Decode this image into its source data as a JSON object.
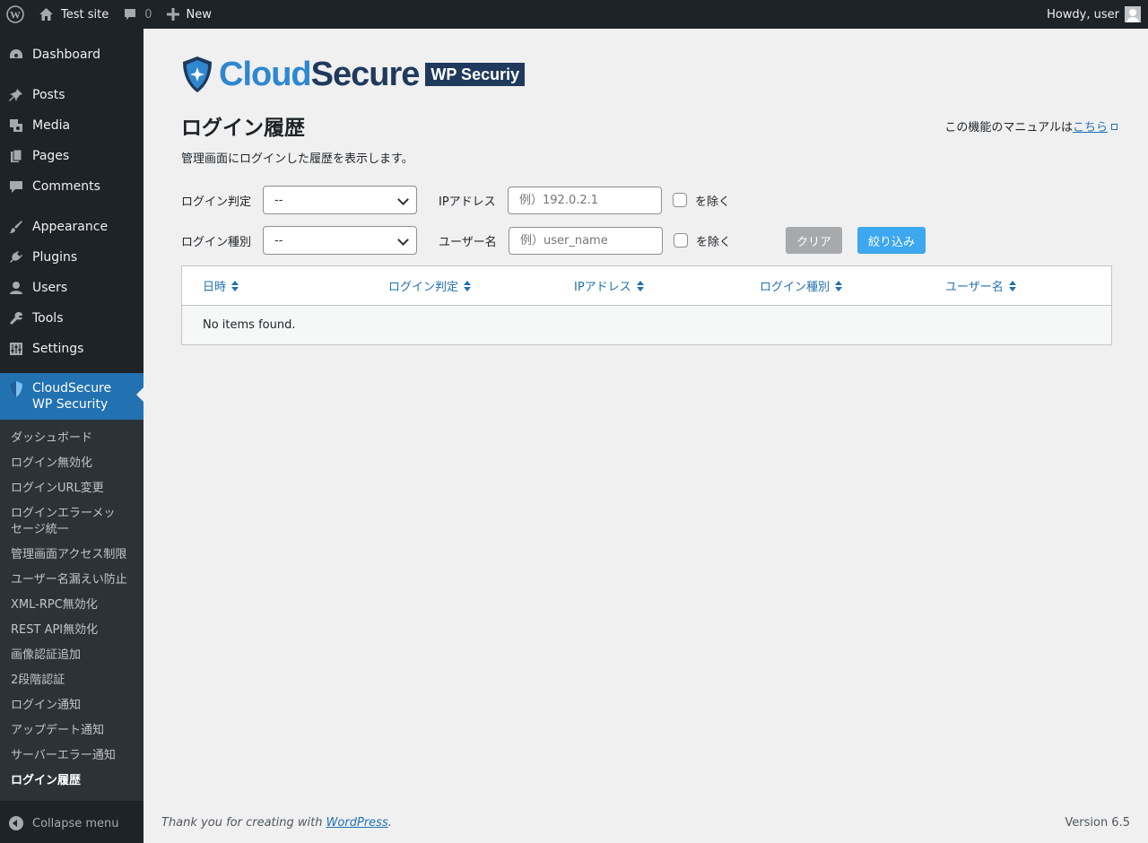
{
  "adminbar": {
    "site_name": "Test site",
    "comments_count": "0",
    "new_label": "New",
    "howdy": "Howdy, user"
  },
  "sidebar": {
    "items": [
      {
        "label": "Dashboard",
        "icon": "dashboard-icon"
      },
      {
        "label": "Posts",
        "icon": "pin-icon"
      },
      {
        "label": "Media",
        "icon": "media-icon"
      },
      {
        "label": "Pages",
        "icon": "pages-icon"
      },
      {
        "label": "Comments",
        "icon": "comment-icon"
      },
      {
        "label": "Appearance",
        "icon": "brush-icon"
      },
      {
        "label": "Plugins",
        "icon": "plugin-icon"
      },
      {
        "label": "Users",
        "icon": "user-icon"
      },
      {
        "label": "Tools",
        "icon": "wrench-icon"
      },
      {
        "label": "Settings",
        "icon": "settings-icon"
      }
    ],
    "active": {
      "label": "CloudSecure WP Security",
      "icon": "shield-icon"
    },
    "submenu": [
      "ダッシュボード",
      "ログイン無効化",
      "ログインURL変更",
      "ログインエラーメッセージ統一",
      "管理画面アクセス制限",
      "ユーザー名漏えい防止",
      "XML-RPC無効化",
      "REST API無効化",
      "画像認証追加",
      "2段階認証",
      "ログイン通知",
      "アップデート通知",
      "サーバーエラー通知",
      "ログイン履歴"
    ],
    "current_index": 13,
    "collapse_label": "Collapse menu"
  },
  "logo": {
    "part1": "Cloud",
    "part2": "Secure",
    "badge": "WP Securiy"
  },
  "page": {
    "title": "ログイン履歴",
    "manual_prefix": "この機能のマニュアルは",
    "manual_link": "こちら",
    "description": "管理画面にログインした履歴を表示します。"
  },
  "filters": {
    "login_result_label": "ログイン判定",
    "login_result_value": "--",
    "ip_label": "IPアドレス",
    "ip_placeholder": "例）192.0.2.1",
    "exclude_label": "を除く",
    "login_type_label": "ログイン種別",
    "login_type_value": "--",
    "username_label": "ユーザー名",
    "username_placeholder": "例）user_name",
    "clear_button": "クリア",
    "filter_button": "絞り込み"
  },
  "table": {
    "columns": [
      "日時",
      "ログイン判定",
      "IPアドレス",
      "ログイン種別",
      "ユーザー名"
    ],
    "empty_message": "No items found."
  },
  "footer": {
    "thanks_prefix": "Thank you for creating with ",
    "wp_link": "WordPress",
    "thanks_suffix": ".",
    "version": "Version 6.5"
  },
  "colors": {
    "adminbar_bg": "#1d2327",
    "accent": "#2271b1",
    "filter_button": "#3da7ef",
    "clear_button": "#a7aaad",
    "logo_blue": "#2f87cf",
    "logo_navy": "#1f3a5c"
  }
}
